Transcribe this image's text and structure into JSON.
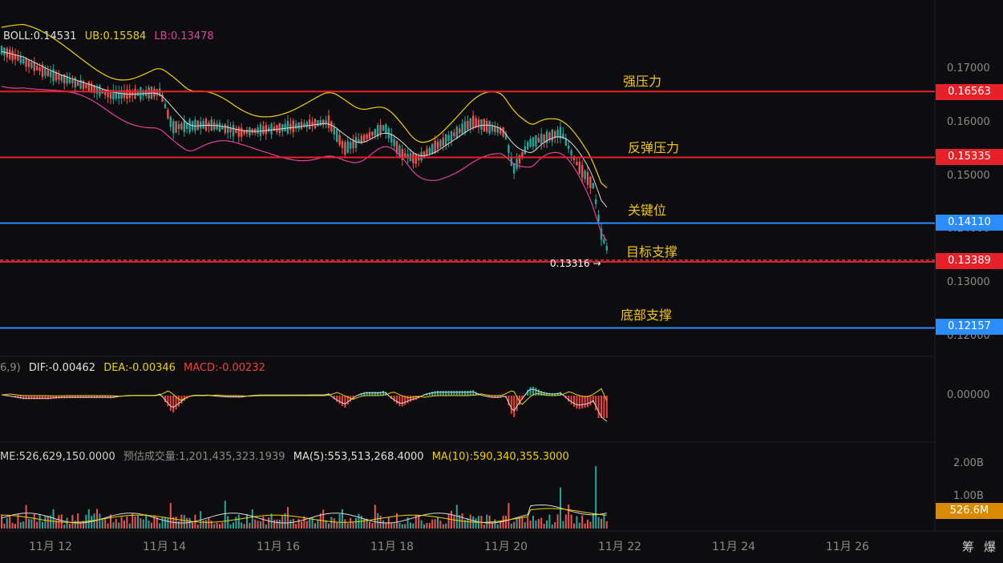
{
  "colors": {
    "background": "#0d0d0f",
    "up": "#26a69a",
    "down": "#ef5350",
    "ma_white": "#d9d9d9",
    "ub_yellow": "#f0d000",
    "lb_magenta": "#e040a0",
    "red_line": "#e8202a",
    "blue_line": "#2a8cff",
    "dea_yellow": "#f0d000",
    "macd_red": "#ef4040",
    "vol_tag": "#d98a00"
  },
  "boll_legend": {
    "boll": "BOLL:0.14531",
    "ub": "UB:0.15584",
    "lb": "LB:0.13478"
  },
  "macd_legend": {
    "params": "6,9)",
    "dif": "DIF:-0.00462",
    "dea": "DEA:-0.00346",
    "macd": "MACD:-0.00232"
  },
  "vol_legend": {
    "vol": "ME:526,629,150.0000",
    "est": "预估成交量:1,201,435,323.1939",
    "ma5": "MA(5):553,513,268.4000",
    "ma10": "MA(10):590,340,355.3000"
  },
  "price_ticks": [
    "0.17000",
    "0.16000",
    "0.15000",
    "0.14000",
    "0.13000",
    "0.12000"
  ],
  "level_tags": [
    {
      "value": "0.16563",
      "kind": "red"
    },
    {
      "value": "0.15335",
      "kind": "red"
    },
    {
      "value": "0.14110",
      "kind": "blue"
    },
    {
      "value": "0.13389",
      "kind": "red"
    },
    {
      "value": "0.12157",
      "kind": "blue"
    }
  ],
  "annotations": [
    "强压力",
    "反弹压力",
    "关键位",
    "目标支撑",
    "底部支撑"
  ],
  "last_low_label": "0.13316 →",
  "macd_ticks": [
    "0.00000"
  ],
  "volume_ticks": [
    "2.00B",
    "1.00B"
  ],
  "volume_tag": "526.6M",
  "x_ticks": [
    "11月 12",
    "11月 14",
    "11月 16",
    "11月 18",
    "11月 20",
    "11月 22",
    "11月 24",
    "11月 26"
  ],
  "corner_buttons": [
    "筹",
    "爆"
  ],
  "chart_data": {
    "type": "candlestick",
    "price_levels": [
      0.16563,
      0.15335,
      0.1411,
      0.13389,
      0.12157
    ],
    "ylim": [
      0.118,
      0.1755
    ],
    "x_range": [
      "11月 11",
      "11月 27"
    ],
    "recent_low": 0.13316,
    "series": [
      {
        "name": "BOLL",
        "last": 0.14531
      },
      {
        "name": "UB",
        "last": 0.15584
      },
      {
        "name": "LB",
        "last": 0.13478
      }
    ],
    "macd": {
      "dif": -0.00462,
      "dea": -0.00346,
      "macd": -0.00232
    },
    "volume": {
      "current": 526629150.0,
      "ma5": 553513268.4,
      "ma10": 590340355.3,
      "ylim": [
        0,
        2000000000
      ]
    }
  }
}
